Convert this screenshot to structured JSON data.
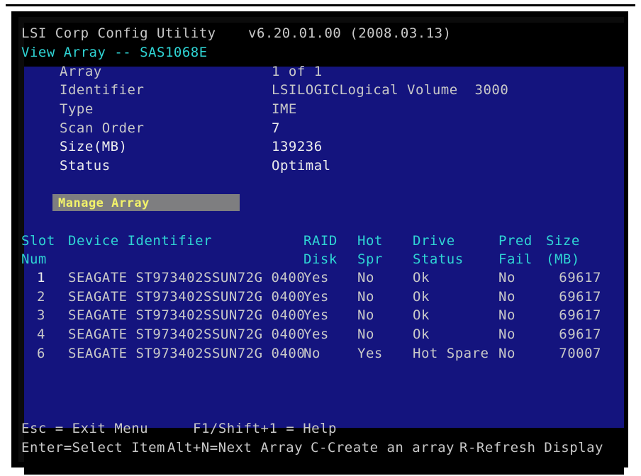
{
  "header": {
    "title": "LSI Corp Config Utility",
    "version": "v6.20.01.00 (2008.03.13)",
    "subtitle": "View Array -- SAS1068E"
  },
  "array_info": {
    "fields": [
      {
        "label": "Array",
        "value": "1 of 1"
      },
      {
        "label": "Identifier",
        "value": "LSILOGICLogical Volume  3000"
      },
      {
        "label": "Type",
        "value": "IME"
      },
      {
        "label": "Scan Order",
        "value": "7"
      },
      {
        "label": "Size(MB)",
        "value": "139236"
      },
      {
        "label": "Status",
        "value": "Optimal"
      }
    ]
  },
  "manage_array": {
    "label": "Manage Array"
  },
  "table": {
    "headers": {
      "slot": [
        "Slot",
        "Num"
      ],
      "device": [
        "Device Identifier",
        ""
      ],
      "raid": [
        "RAID",
        "Disk"
      ],
      "hot": [
        "Hot",
        "Spr"
      ],
      "drive": [
        "Drive",
        "Status"
      ],
      "pred": [
        "Pred",
        "Fail"
      ],
      "size": [
        "Size",
        "(MB)"
      ]
    },
    "rows": [
      {
        "slot": "1",
        "device": "SEAGATE ST973402SSUN72G 0400",
        "raid": "Yes",
        "hot": "No",
        "drive": "Ok",
        "pred": "No",
        "size": "69617"
      },
      {
        "slot": "2",
        "device": "SEAGATE ST973402SSUN72G 0400",
        "raid": "Yes",
        "hot": "No",
        "drive": "Ok",
        "pred": "No",
        "size": "69617"
      },
      {
        "slot": "3",
        "device": "SEAGATE ST973402SSUN72G 0400",
        "raid": "Yes",
        "hot": "No",
        "drive": "Ok",
        "pred": "No",
        "size": "69617"
      },
      {
        "slot": "4",
        "device": "SEAGATE ST973402SSUN72G 0400",
        "raid": "Yes",
        "hot": "No",
        "drive": "Ok",
        "pred": "No",
        "size": "69617"
      },
      {
        "slot": "6",
        "device": "SEAGATE ST973402SSUN72G 0400",
        "raid": "No",
        "hot": "Yes",
        "drive": "Hot Spare",
        "pred": "No",
        "size": "70007"
      }
    ]
  },
  "footer": {
    "line1_left": "Esc = Exit Menu",
    "line1_right": "F1/Shift+1 = Help",
    "line2": [
      "Enter=Select Item",
      "Alt+N=Next Array",
      "C-Create an array",
      "R-Refresh Display"
    ]
  },
  "colors": {
    "panel_bg": "#14147e",
    "header_text": "#c8c8c8",
    "cyan_text": "#2fd4d4",
    "highlight_text": "#f2f26a",
    "highlight_bg": "#7e7e80"
  }
}
